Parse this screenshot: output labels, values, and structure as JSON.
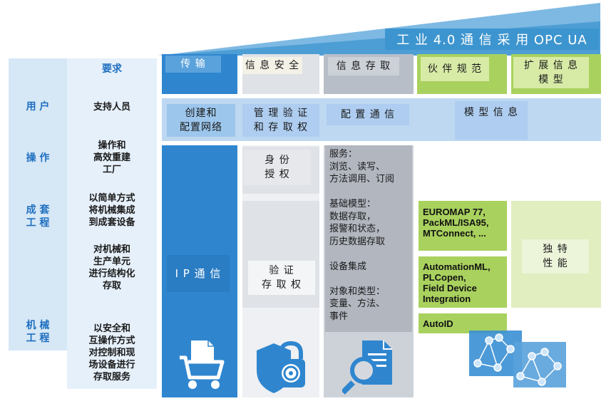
{
  "header": {
    "title": "工 业 4.0 通 信 采 用 OPC UA"
  },
  "left_roles": [
    {
      "label": "用 户"
    },
    {
      "label": "操 作"
    },
    {
      "label": "成 套\n工 程"
    },
    {
      "label": "机 械\n工 程"
    }
  ],
  "requirements": {
    "title": "要求",
    "items": [
      "支持人员",
      "操作和\n高效重建\n工厂",
      "以简单方式\n将机械集成\n到成套设备",
      "对机械和\n生产单元\n进行结构化\n存取",
      "以安全和\n互操作方式\n对控制和现\n场设备进行\n存取服务"
    ]
  },
  "top_categories": {
    "transport": "传 输",
    "info_security": "信 息 安 全",
    "info_access": "信 息 存 取",
    "partner_spec": "伙 伴 规 范",
    "extended_model": "扩 展 信 息\n模 型"
  },
  "band": {
    "create_network": "创建和\n配置网络",
    "manage_auth": "管 理 验 证\n和 存 取 权",
    "config_comm": "配 置 通 信",
    "model_info": "模 型 信 息"
  },
  "columns": {
    "ip_comm": "I P 通 信",
    "identity_auth": "身 份\n授 权",
    "verify_access": "验 证\n存 取 权",
    "services": "服务：\n浏览、读写、\n方法调用、订阅\n\n基础模型：\n数据存取，\n报警和状态，\n历史数据存取\n\n设备集成\n\n对象和类型：\n变量、方法、\n事件",
    "standards": [
      "EUROMAP 77,\nPackML/ISA95,\nMTConnect, ...",
      "AutomationML,\nPLCopen,\nField Device\nIntegration",
      "AutoID"
    ],
    "unique_perf": "独 特\n性 能"
  },
  "icons": [
    "cart-icon",
    "shield-lock-icon",
    "document-magnifier-icon",
    "network-graph-icon"
  ],
  "colors": {
    "primary_blue": "#2f86cf",
    "header_blue": "#3d95cf",
    "label_blue": "#1e6fc0",
    "green": "#a9d15e",
    "grey": "#b8bec8"
  }
}
